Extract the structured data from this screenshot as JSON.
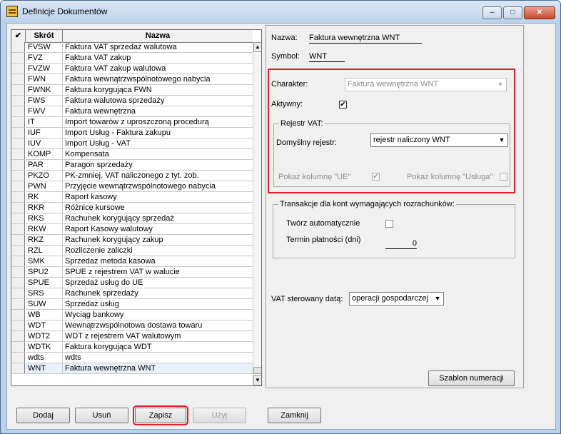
{
  "window": {
    "title": "Definicje Dokumentów",
    "controls": {
      "minimize": "–",
      "maximize": "□",
      "close": "✕"
    }
  },
  "grid": {
    "headers": {
      "check": "✔",
      "code": "Skrót",
      "name": "Nazwa"
    },
    "selected_index": 30,
    "rows": [
      {
        "code": "FVSW",
        "name": "Faktura VAT sprzedaż walutowa"
      },
      {
        "code": "FVZ",
        "name": "Faktura VAT zakup"
      },
      {
        "code": "FVZW",
        "name": "Faktura VAT zakup walutowa"
      },
      {
        "code": "FWN",
        "name": "Faktura wewnątrzwspólnotowego nabycia"
      },
      {
        "code": "FWNK",
        "name": "Faktura korygująca FWN"
      },
      {
        "code": "FWS",
        "name": "Faktura walutowa sprzedaży"
      },
      {
        "code": "FWV",
        "name": "Faktura wewnętrzna"
      },
      {
        "code": "IT",
        "name": "Import towarów z uproszczoną procedurą"
      },
      {
        "code": "IUF",
        "name": "Import Usług - Faktura zakupu"
      },
      {
        "code": "IUV",
        "name": "Import Usług - VAT"
      },
      {
        "code": "KOMP",
        "name": "Kompensata"
      },
      {
        "code": "PAR",
        "name": "Paragon sprzedaży"
      },
      {
        "code": "PKZO",
        "name": "PK-zmniej. VAT naliczonego z tyt. zob."
      },
      {
        "code": "PWN",
        "name": "Przyjęcie wewnątrzwspólnotowego nabycia"
      },
      {
        "code": "RK",
        "name": "Raport kasowy"
      },
      {
        "code": "RKR",
        "name": "Różnice kursowe"
      },
      {
        "code": "RKS",
        "name": "Rachunek korygujący sprzedaż"
      },
      {
        "code": "RKW",
        "name": "Raport Kasowy walutowy"
      },
      {
        "code": "RKZ",
        "name": "Rachunek korygujący zakup"
      },
      {
        "code": "RZL",
        "name": "Rozliczenie zaliczki"
      },
      {
        "code": "SMK",
        "name": "Sprzedaż metoda kasowa"
      },
      {
        "code": "SPU2",
        "name": "SPUE z rejestrem VAT w walucie"
      },
      {
        "code": "SPUE",
        "name": "Sprzedaż usług do UE"
      },
      {
        "code": "SRS",
        "name": "Rachunek sprzedaży"
      },
      {
        "code": "SUW",
        "name": "Sprzedaż usług"
      },
      {
        "code": "WB",
        "name": "Wyciąg bankowy"
      },
      {
        "code": "WDT",
        "name": "Wewnątrzwspólnotowa dostawa towaru"
      },
      {
        "code": "WDT2",
        "name": "WDT z rejestrem VAT walutowym"
      },
      {
        "code": "WDTK",
        "name": "Faktura korygująca WDT"
      },
      {
        "code": "wdts",
        "name": "wdts"
      },
      {
        "code": "WNT",
        "name": "Faktura wewnętrzna WNT"
      }
    ]
  },
  "form": {
    "nazwa_label": "Nazwa:",
    "nazwa_value": "Faktura wewnętrzna WNT",
    "symbol_label": "Symbol:",
    "symbol_value": "WNT",
    "charakter_label": "Charakter:",
    "charakter_value": "Faktura wewnętrzna WNT",
    "aktywny_label": "Aktywny:",
    "aktywny_checked": "✔",
    "rejestr_group": "Rejestr VAT:",
    "domyslny_label": "Domyślny rejestr:",
    "domyslny_value": "rejestr naliczony WNT",
    "pokaz_ue_label": "Pokaż kolumnę \"UE\"",
    "pokaz_ue_checked": "✔",
    "pokaz_usluga_label": "Pokaż kolumnę \"Usługa\"",
    "transakcje_group": "Transakcje dla kont wymagających rozrachunków:",
    "tworz_label": "Twórz automatycznie",
    "termin_label": "Termin płatności (dni)",
    "termin_value": "0",
    "vat_label": "VAT sterowany datą:",
    "vat_value": "operacji gospodarczej",
    "szablon_button": "Szablon numeracji"
  },
  "buttons": {
    "dodaj": "Dodaj",
    "usun": "Usuń",
    "zapisz": "Zapisz",
    "uzyj": "Użyj",
    "zamknij": "Zamknij"
  },
  "colors": {
    "highlight_red": "#e0202a",
    "titlebar": "#bcd2ea",
    "panel": "#f0f0f0"
  }
}
